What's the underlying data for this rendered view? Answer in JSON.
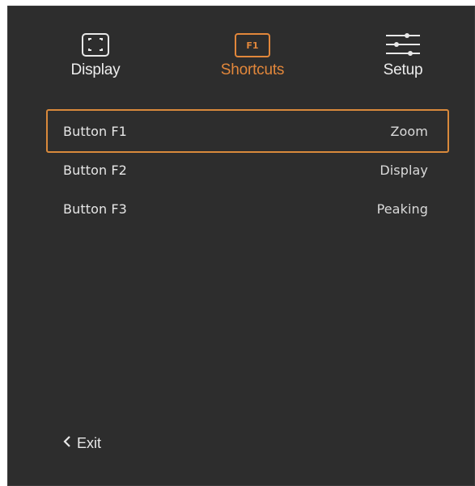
{
  "tabs": [
    {
      "label": "Display",
      "icon": "focus-frame-icon",
      "active": false
    },
    {
      "label": "Shortcuts",
      "icon": "f1-key-icon",
      "icon_text": "F1",
      "active": true
    },
    {
      "label": "Setup",
      "icon": "sliders-icon",
      "active": false
    }
  ],
  "shortcuts": [
    {
      "label": "Button F1",
      "value": "Zoom",
      "selected": true
    },
    {
      "label": "Button F2",
      "value": "Display",
      "selected": false
    },
    {
      "label": "Button F3",
      "value": "Peaking",
      "selected": false
    }
  ],
  "exit": {
    "label": "Exit",
    "icon": "chevron-left-icon"
  },
  "colors": {
    "background": "#2d2d2d",
    "accent": "#e2873b",
    "text": "#e6e6e6"
  }
}
